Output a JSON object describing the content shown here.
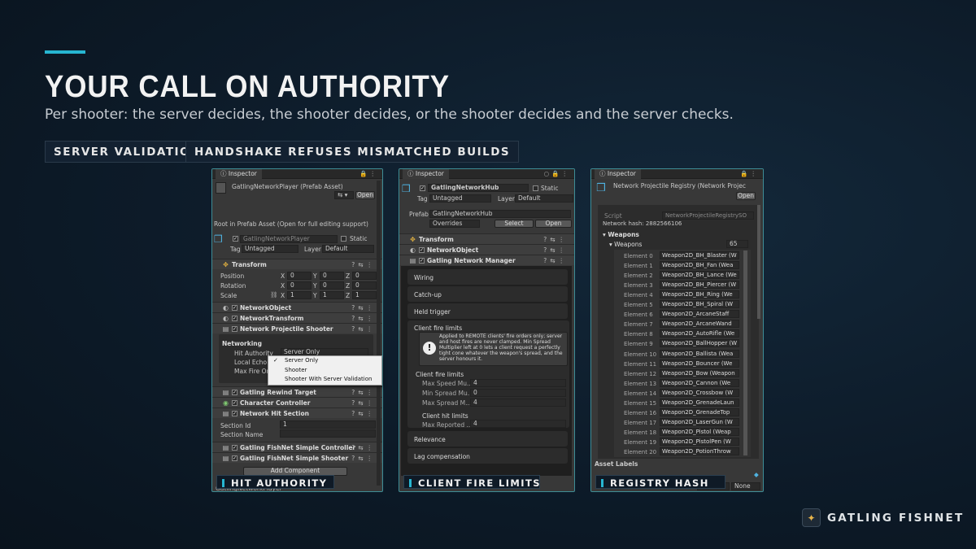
{
  "header": {
    "title": "YOUR CALL ON AUTHORITY",
    "subtitle": "Per shooter: the server decides, the shooter decides, or the shooter decides and the server checks."
  },
  "tags": [
    "SERVER VALIDATION",
    "HANDSHAKE REFUSES MISMATCHED BUILDS"
  ],
  "p1": {
    "tab": "Inspector",
    "asset": "GatlingNetworkPlayer (Prefab Asset)",
    "open": "Open",
    "root_note": "Root in Prefab Asset (Open for full editing support)",
    "obj_name": "GatlingNetworkPlayer",
    "static": "Static",
    "tag_label": "Tag",
    "tag_value": "Untagged",
    "layer_label": "Layer",
    "layer_value": "Default",
    "transform": "Transform",
    "position": "Position",
    "rotation": "Rotation",
    "scale": "Scale",
    "x": "X",
    "y": "Y",
    "z": "Z",
    "pos": [
      "0",
      "0",
      "0"
    ],
    "rot": [
      "0",
      "0",
      "0"
    ],
    "scl": [
      "1",
      "1",
      "1"
    ],
    "comps_a": [
      "NetworkObject",
      "NetworkTransform",
      "Network Projectile Shooter"
    ],
    "networking": "Networking",
    "hit_authority": "Hit Authority",
    "hit_value": "Server Only",
    "local_echo": "Local Echo",
    "max_fire": "Max Fire Origi",
    "dropdown": [
      "Server Only",
      "Shooter",
      "Shooter With Server Validation"
    ],
    "comps_b": [
      "Gatling Rewind Target",
      "Character Controller",
      "Network Hit Section"
    ],
    "section_id": "Section Id",
    "section_id_value": "1",
    "section_name": "Section Name",
    "comps_c": [
      "Gatling FishNet Simple Controller",
      "Gatling FishNet Simple Shooter"
    ],
    "add_component": "Add Component",
    "footer": "GatlingNetworkPlayer",
    "caption": "HIT AUTHORITY"
  },
  "p2": {
    "tab": "Inspector",
    "obj_name": "GatlingNetworkHub",
    "static": "Static",
    "tag_label": "Tag",
    "tag_value": "Untagged",
    "layer_label": "Layer",
    "layer_value": "Default",
    "prefab": "Prefab",
    "prefab_value": "GatlingNetworkHub",
    "overrides": "Overrides",
    "select": "Select",
    "open": "Open",
    "comps": [
      "Transform",
      "NetworkObject",
      "Gatling Network Manager"
    ],
    "folds_a": [
      "Wiring",
      "Catch-up",
      "Held trigger"
    ],
    "client_fire": "Client fire limits",
    "help": "Applied to REMOTE clients' fire orders only; server and host fires are never clamped. Min Spread Multiplier left at 0 lets a client request a perfectly tight cone whatever the weapon's spread, and the server honours it.",
    "cfl_header": "Client fire limits",
    "fields": [
      {
        "k": "Max Speed Mu...",
        "v": "4"
      },
      {
        "k": "Min Spread Mu...",
        "v": "0"
      },
      {
        "k": "Max Spread M...",
        "v": "4"
      }
    ],
    "chl_header": "Client hit limits",
    "max_reported": "Max Reported ...",
    "max_reported_v": "4",
    "folds_b": [
      "Relevance",
      "Lag compensation"
    ],
    "caption": "CLIENT FIRE LIMITS"
  },
  "p3": {
    "tab": "Inspector",
    "asset": "Network Projectile Registry (Network Projec",
    "open": "Open",
    "script": "Script",
    "script_value": "NetworkProjectileRegistrySO",
    "hash": "Network hash: 2882566106",
    "weapons": "Weapons",
    "weapons_sub": "Weapons",
    "count": "65",
    "elements": [
      {
        "n": "Element 0",
        "v": "Weapon2D_BH_Blaster (W"
      },
      {
        "n": "Element 1",
        "v": "Weapon2D_BH_Fan (Wea"
      },
      {
        "n": "Element 2",
        "v": "Weapon2D_BH_Lance (We"
      },
      {
        "n": "Element 3",
        "v": "Weapon2D_BH_Piercer (W"
      },
      {
        "n": "Element 4",
        "v": "Weapon2D_BH_Ring (We"
      },
      {
        "n": "Element 5",
        "v": "Weapon2D_BH_Spiral (W"
      },
      {
        "n": "Element 6",
        "v": "Weapon2D_ArcaneStaff"
      },
      {
        "n": "Element 7",
        "v": "Weapon2D_ArcaneWand"
      },
      {
        "n": "Element 8",
        "v": "Weapon2D_AutoRifle (We"
      },
      {
        "n": "Element 9",
        "v": "Weapon2D_BallHopper (W"
      },
      {
        "n": "Element 10",
        "v": "Weapon2D_Ballista (Wea"
      },
      {
        "n": "Element 11",
        "v": "Weapon2D_Bouncer (We"
      },
      {
        "n": "Element 12",
        "v": "Weapon2D_Bow (Weapon"
      },
      {
        "n": "Element 13",
        "v": "Weapon2D_Cannon (We"
      },
      {
        "n": "Element 14",
        "v": "Weapon2D_Crossbow (W"
      },
      {
        "n": "Element 15",
        "v": "Weapon2D_GrenadeLaun"
      },
      {
        "n": "Element 16",
        "v": "Weapon2D_GrenadeTop"
      },
      {
        "n": "Element 17",
        "v": "Weapon2D_LaserGun (W"
      },
      {
        "n": "Element 18",
        "v": "Weapon2D_Pistol (Weap"
      },
      {
        "n": "Element 19",
        "v": "Weapon2D_PistolPen (W"
      },
      {
        "n": "Element 20",
        "v": "Weapon2D_PotionThrow"
      }
    ],
    "asset_labels": "Asset Labels",
    "none": "None",
    "caption": "REGISTRY HASH"
  },
  "brand": {
    "name": "GATLING FISHNET"
  },
  "colors": {
    "accent": "#27b6d1",
    "panel_border": "#3e8d96"
  }
}
